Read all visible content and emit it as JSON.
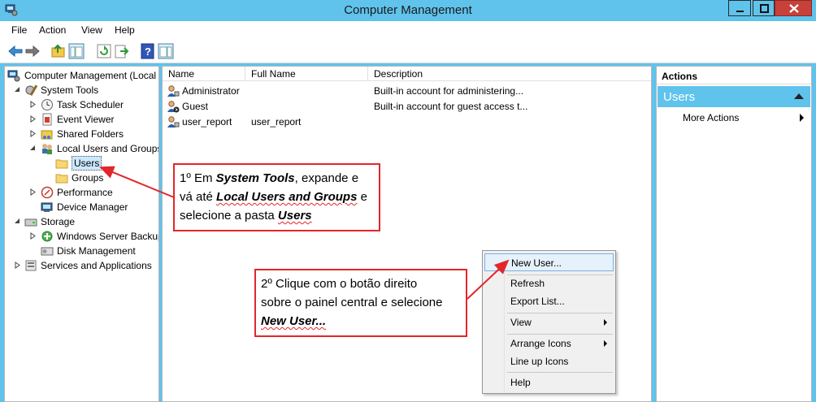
{
  "window": {
    "title": "Computer Management",
    "controls": {
      "minimize": "minimize-icon",
      "maximize": "maximize-icon",
      "close": "close-icon"
    }
  },
  "menu": [
    "File",
    "Action",
    "View",
    "Help"
  ],
  "toolbar": [
    "back-icon",
    "forward-icon",
    "up-folder-icon",
    "show-hide-tree-icon",
    "refresh-icon",
    "export-list-icon",
    "help-icon",
    "show-hide-action-pane-icon"
  ],
  "tree": [
    {
      "label": "Computer Management (Local",
      "icon": "computer-management-icon",
      "expander": ""
    },
    {
      "label": "System Tools",
      "icon": "system-tools-icon",
      "expander": "open"
    },
    {
      "label": "Task Scheduler",
      "icon": "clock-icon",
      "expander": "closed"
    },
    {
      "label": "Event Viewer",
      "icon": "event-viewer-icon",
      "expander": "closed"
    },
    {
      "label": "Shared Folders",
      "icon": "shared-folder-icon",
      "expander": "closed"
    },
    {
      "label": "Local Users and Groups",
      "icon": "users-group-icon",
      "expander": "open"
    },
    {
      "label": "Users",
      "icon": "folder-icon",
      "expander": "",
      "selected": true
    },
    {
      "label": "Groups",
      "icon": "folder-icon",
      "expander": ""
    },
    {
      "label": "Performance",
      "icon": "performance-icon",
      "expander": "closed"
    },
    {
      "label": "Device Manager",
      "icon": "device-manager-icon",
      "expander": ""
    },
    {
      "label": "Storage",
      "icon": "storage-icon",
      "expander": "open"
    },
    {
      "label": "Windows Server Backup",
      "icon": "backup-icon",
      "expander": "closed"
    },
    {
      "label": "Disk Management",
      "icon": "disk-icon",
      "expander": ""
    },
    {
      "label": "Services and Applications",
      "icon": "services-icon",
      "expander": "closed"
    }
  ],
  "list": {
    "columns": [
      "Name",
      "Full Name",
      "Description"
    ],
    "rows": [
      {
        "name": "Administrator",
        "full_name": "",
        "description": "Built-in account for administering...",
        "icon": "user-icon"
      },
      {
        "name": "Guest",
        "full_name": "",
        "description": "Built-in account for guest access t...",
        "icon": "disabled-user-icon"
      },
      {
        "name": "user_report",
        "full_name": "user_report",
        "description": "",
        "icon": "user-icon"
      }
    ]
  },
  "actions": {
    "header": "Actions",
    "section": "Users",
    "more": "More Actions"
  },
  "context_menu": [
    {
      "label": "New User...",
      "highlighted": true,
      "submenu": false
    },
    {
      "label": "Refresh",
      "submenu": false
    },
    {
      "label": "Export List...",
      "submenu": false
    },
    {
      "label": "View",
      "submenu": true
    },
    {
      "label": "Arrange Icons",
      "submenu": true
    },
    {
      "label": "Line up Icons",
      "submenu": false
    },
    {
      "label": "Help",
      "submenu": false
    }
  ],
  "callout1": {
    "p1": "1º Em ",
    "e1": "System Tools",
    "p2": ", expande e",
    "p3": "vá até ",
    "e2": "Local Users and Groups",
    "p4": " e",
    "p5": "selecione a pasta ",
    "e3": "Users"
  },
  "callout2": {
    "line1": "2º Clique com o botão direito",
    "line2": "sobre o painel central e selecione",
    "e1": "New User..."
  },
  "colors": {
    "titlebar": "#5fc3ec",
    "callout_border": "#e3262b",
    "close_button": "#c7403a"
  }
}
